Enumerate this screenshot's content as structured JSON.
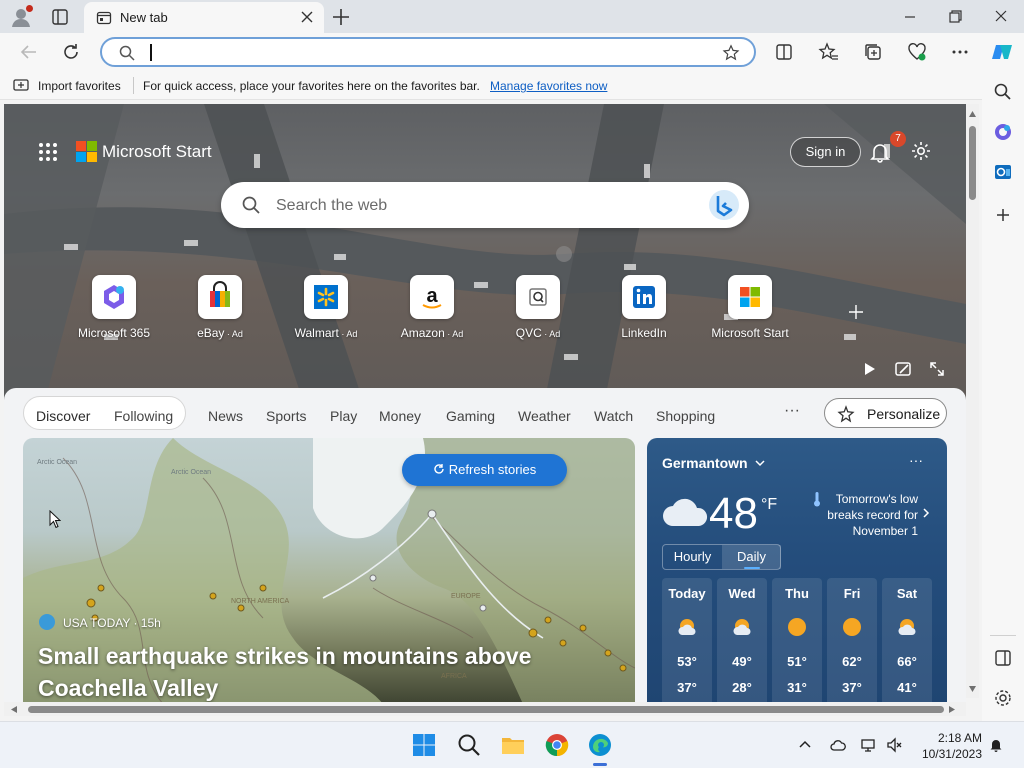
{
  "browser": {
    "tab": {
      "title": "New tab"
    },
    "address_bar": {
      "value": "",
      "placeholder": ""
    },
    "favorites_bar": {
      "import_label": "Import favorites",
      "message": "For quick access, place your favorites here on the favorites bar.",
      "manage_link": "Manage favorites now"
    }
  },
  "page": {
    "brand": "Microsoft Start",
    "sign_in": "Sign in",
    "notification_count": "7",
    "search_placeholder": "Search the web",
    "quick_links": [
      {
        "label": "Microsoft 365",
        "ad": ""
      },
      {
        "label": "eBay",
        "ad": " · Ad"
      },
      {
        "label": "Walmart",
        "ad": " · Ad"
      },
      {
        "label": "Amazon",
        "ad": " · Ad"
      },
      {
        "label": "QVC",
        "ad": " · Ad"
      },
      {
        "label": "LinkedIn",
        "ad": ""
      },
      {
        "label": "Microsoft Start",
        "ad": ""
      }
    ],
    "feed_tabs": [
      "Discover",
      "Following",
      "News",
      "Sports",
      "Play",
      "Money",
      "Gaming",
      "Weather",
      "Watch",
      "Shopping"
    ],
    "more": "···",
    "personalize": "Personalize"
  },
  "news_card": {
    "refresh": "Refresh stories",
    "source": "USA TODAY · 15h",
    "headline": "Small earthquake strikes in mountains above Coachella Valley",
    "map_labels": [
      "Arctic Ocean",
      "Arctic Ocean",
      "NORTH AMERICA",
      "EUROPE",
      "AFRICA"
    ]
  },
  "weather": {
    "location": "Germantown",
    "more": "···",
    "temp": "48",
    "unit": "°F",
    "alert": "Tomorrow's low breaks record for November 1",
    "toggle": [
      "Hourly",
      "Daily"
    ],
    "days": [
      {
        "day": "Today",
        "hi": "53°",
        "lo": "37°",
        "icon": "partly-sunny-icon"
      },
      {
        "day": "Wed",
        "hi": "49°",
        "lo": "28°",
        "icon": "partly-sunny-icon"
      },
      {
        "day": "Thu",
        "hi": "51°",
        "lo": "31°",
        "icon": "sunny-icon"
      },
      {
        "day": "Fri",
        "hi": "62°",
        "lo": "37°",
        "icon": "sunny-icon"
      },
      {
        "day": "Sat",
        "hi": "66°",
        "lo": "41°",
        "icon": "partly-sunny-icon"
      }
    ]
  },
  "taskbar": {
    "time": "2:18 AM",
    "date": "10/31/2023"
  },
  "colors": {
    "accent": "#1f74d4",
    "link": "#0f5fc4",
    "badge": "#d9482b"
  }
}
